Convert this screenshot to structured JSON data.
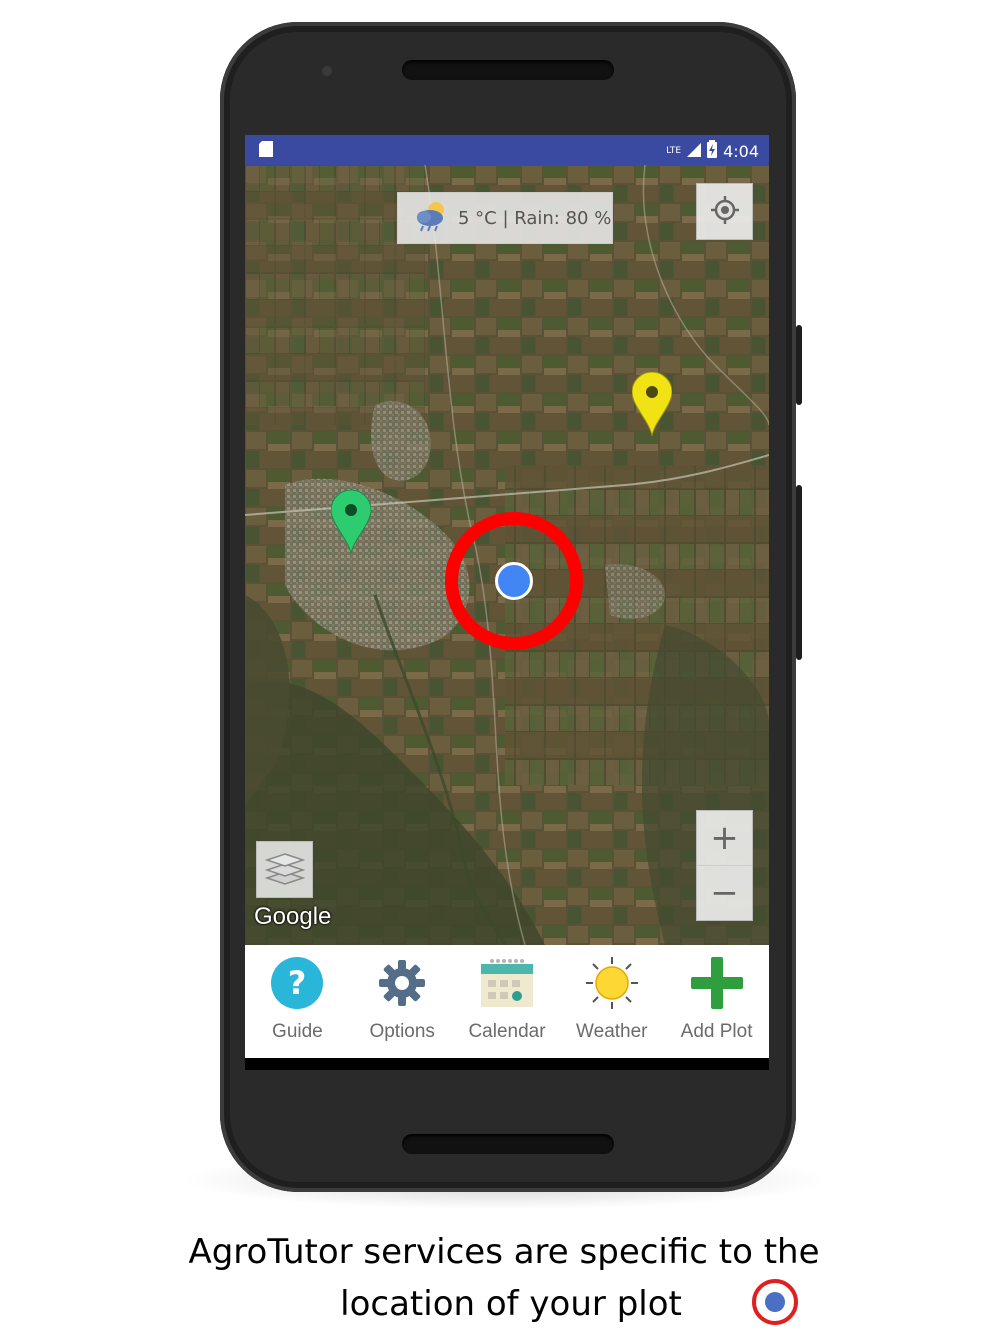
{
  "status_bar": {
    "network": "LTE",
    "time": "4:04"
  },
  "map": {
    "weather_chip": {
      "icon": "partly-cloudy-rain-icon",
      "text": "5 °C | Rain: 80 %"
    },
    "zoom_in_label": "+",
    "zoom_out_label": "−",
    "attribution": "Google",
    "markers": [
      {
        "color": "#2ecc71",
        "name": "green-marker"
      },
      {
        "color": "#f1e313",
        "name": "yellow-marker"
      }
    ],
    "current_location_color": "#4285f4",
    "highlight_color": "#ff0000"
  },
  "bottom_nav": {
    "items": [
      {
        "label": "Guide",
        "icon": "question-circle-icon",
        "color": "#29b6d9"
      },
      {
        "label": "Options",
        "icon": "gear-icon",
        "color": "#546e8a"
      },
      {
        "label": "Calendar",
        "icon": "calendar-icon",
        "color": "#4db6ac"
      },
      {
        "label": "Weather",
        "icon": "sun-icon",
        "color": "#fdd835"
      },
      {
        "label": "Add Plot",
        "icon": "plus-icon",
        "color": "#2e9e3e"
      }
    ]
  },
  "caption": {
    "line1": "AgroTutor services are specific to the",
    "line2": "location of your plot"
  }
}
